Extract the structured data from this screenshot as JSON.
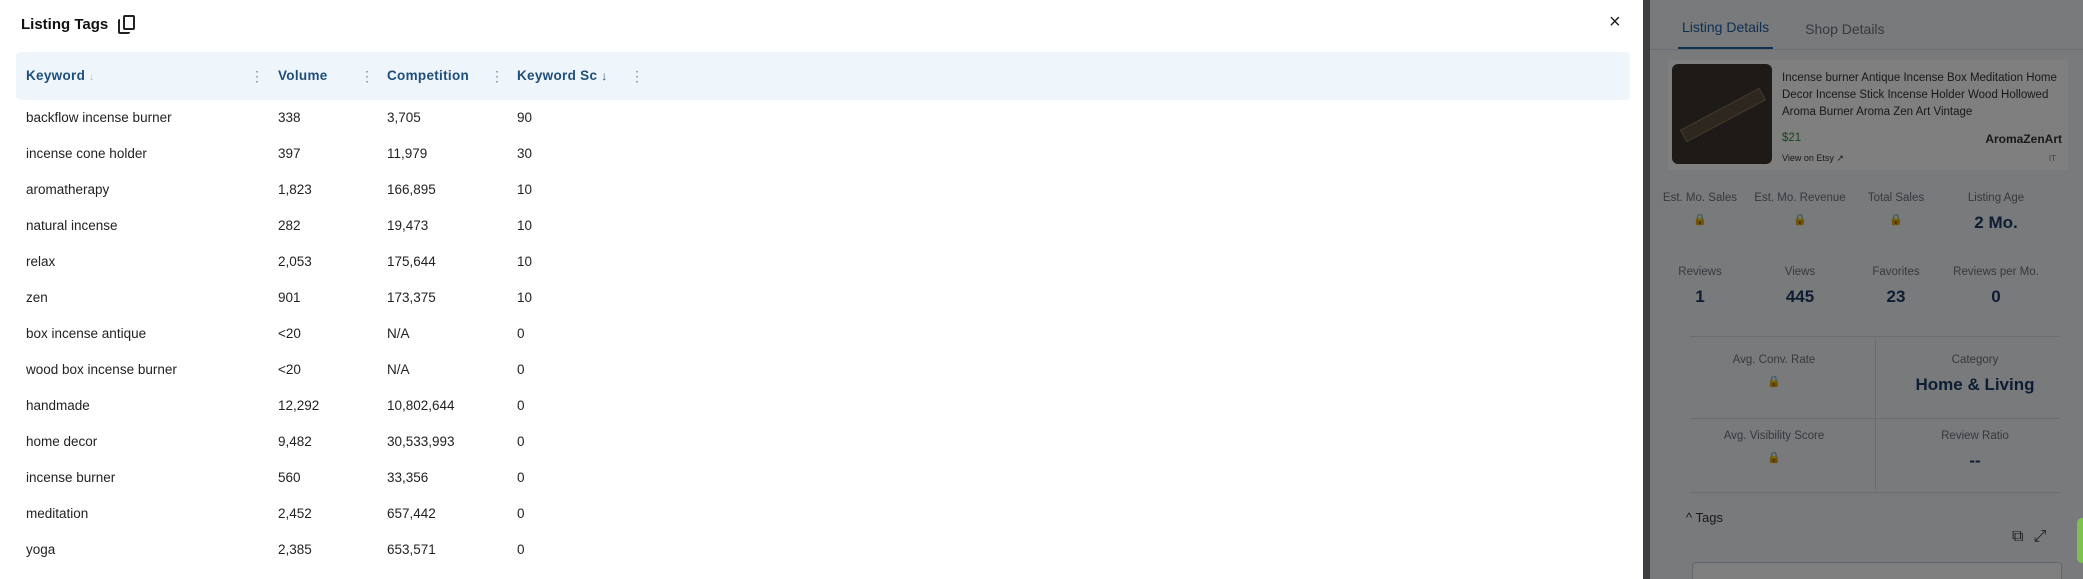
{
  "modal": {
    "title": "Listing Tags",
    "close_symbol": "×",
    "columns": [
      {
        "label": "Keyword",
        "sort": "↓"
      },
      {
        "label": "Volume",
        "sort": ""
      },
      {
        "label": "Competition",
        "sort": ""
      },
      {
        "label": "Keyword Sc",
        "sort": "↓"
      }
    ],
    "menu_symbol": "⋮",
    "rows": [
      {
        "keyword": "backflow incense burner",
        "volume": "338",
        "competition": "3,705",
        "score": "90"
      },
      {
        "keyword": "incense cone holder",
        "volume": "397",
        "competition": "11,979",
        "score": "30"
      },
      {
        "keyword": "aromatherapy",
        "volume": "1,823",
        "competition": "166,895",
        "score": "10"
      },
      {
        "keyword": "natural incense",
        "volume": "282",
        "competition": "19,473",
        "score": "10"
      },
      {
        "keyword": "relax",
        "volume": "2,053",
        "competition": "175,644",
        "score": "10"
      },
      {
        "keyword": "zen",
        "volume": "901",
        "competition": "173,375",
        "score": "10"
      },
      {
        "keyword": "box incense antique",
        "volume": "<20",
        "competition": "N/A",
        "score": "0"
      },
      {
        "keyword": "wood box incense burner",
        "volume": "<20",
        "competition": "N/A",
        "score": "0"
      },
      {
        "keyword": "handmade",
        "volume": "12,292",
        "competition": "10,802,644",
        "score": "0"
      },
      {
        "keyword": "home decor",
        "volume": "9,482",
        "competition": "30,533,993",
        "score": "0"
      },
      {
        "keyword": "incense burner",
        "volume": "560",
        "competition": "33,356",
        "score": "0"
      },
      {
        "keyword": "meditation",
        "volume": "2,452",
        "competition": "657,442",
        "score": "0"
      },
      {
        "keyword": "yoga",
        "volume": "2,385",
        "competition": "653,571",
        "score": "0"
      }
    ]
  },
  "panel": {
    "tabs": [
      "Listing Details",
      "Shop Details"
    ],
    "listing_title": "Incense burner Antique Incense Box Meditation Home Decor Incense Stick Incense Holder Wood Hollowed Aroma Burner Aroma Zen Art Vintage",
    "price": "$21",
    "shop_name": "AromaZenArt",
    "view_on_etsy": "View on Etsy ↗",
    "country": "IT",
    "stats_row1": [
      {
        "label": "Est. Mo. Sales",
        "value": "🔒"
      },
      {
        "label": "Est. Mo. Revenue",
        "value": "🔒"
      },
      {
        "label": "Total Sales",
        "value": "🔒"
      },
      {
        "label": "Listing Age",
        "value": "2 Mo."
      }
    ],
    "stats_row2": [
      {
        "label": "Reviews",
        "value": "1"
      },
      {
        "label": "Views",
        "value": "445"
      },
      {
        "label": "Favorites",
        "value": "23"
      },
      {
        "label": "Reviews per Mo.",
        "value": "0"
      }
    ],
    "avg_conv_rate": {
      "label": "Avg. Conv. Rate",
      "value": "🔒"
    },
    "category": {
      "label": "Category",
      "value": "Home & Living"
    },
    "avg_visibility": {
      "label": "Avg. Visibility Score",
      "value": "🔒"
    },
    "review_ratio": {
      "label": "Review Ratio",
      "value": "--"
    },
    "tags_label": "Tags",
    "tags_chevron": "^"
  }
}
